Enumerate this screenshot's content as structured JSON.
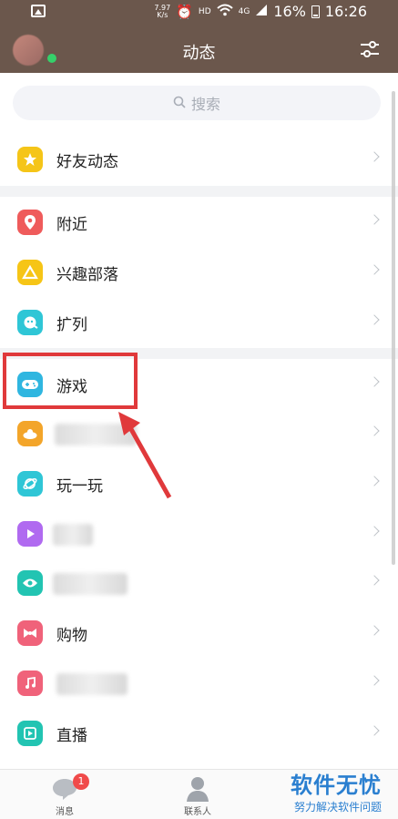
{
  "status_bar": {
    "net_speed_value": "7.97",
    "net_speed_unit": "K/s",
    "hd": "HD",
    "signal_label": "4G",
    "battery": "16%",
    "time": "16:26"
  },
  "header": {
    "title": "动态"
  },
  "search": {
    "placeholder": "搜索"
  },
  "list": {
    "friends": "好友动态",
    "nearby": "附近",
    "interest": "兴趣部落",
    "expand": "扩列",
    "games": "游戏",
    "play": "玩一玩",
    "shopping": "购物",
    "live": "直播"
  },
  "tabbar": {
    "messages": "消息",
    "messages_badge": "1",
    "contacts": "联系人"
  },
  "watermark": {
    "title": "软件无忧",
    "subtitle": "努力解决软件问题"
  },
  "colors": {
    "header_bg": "#6b574c",
    "highlight_border": "#e0393b",
    "online": "#35d06a"
  }
}
